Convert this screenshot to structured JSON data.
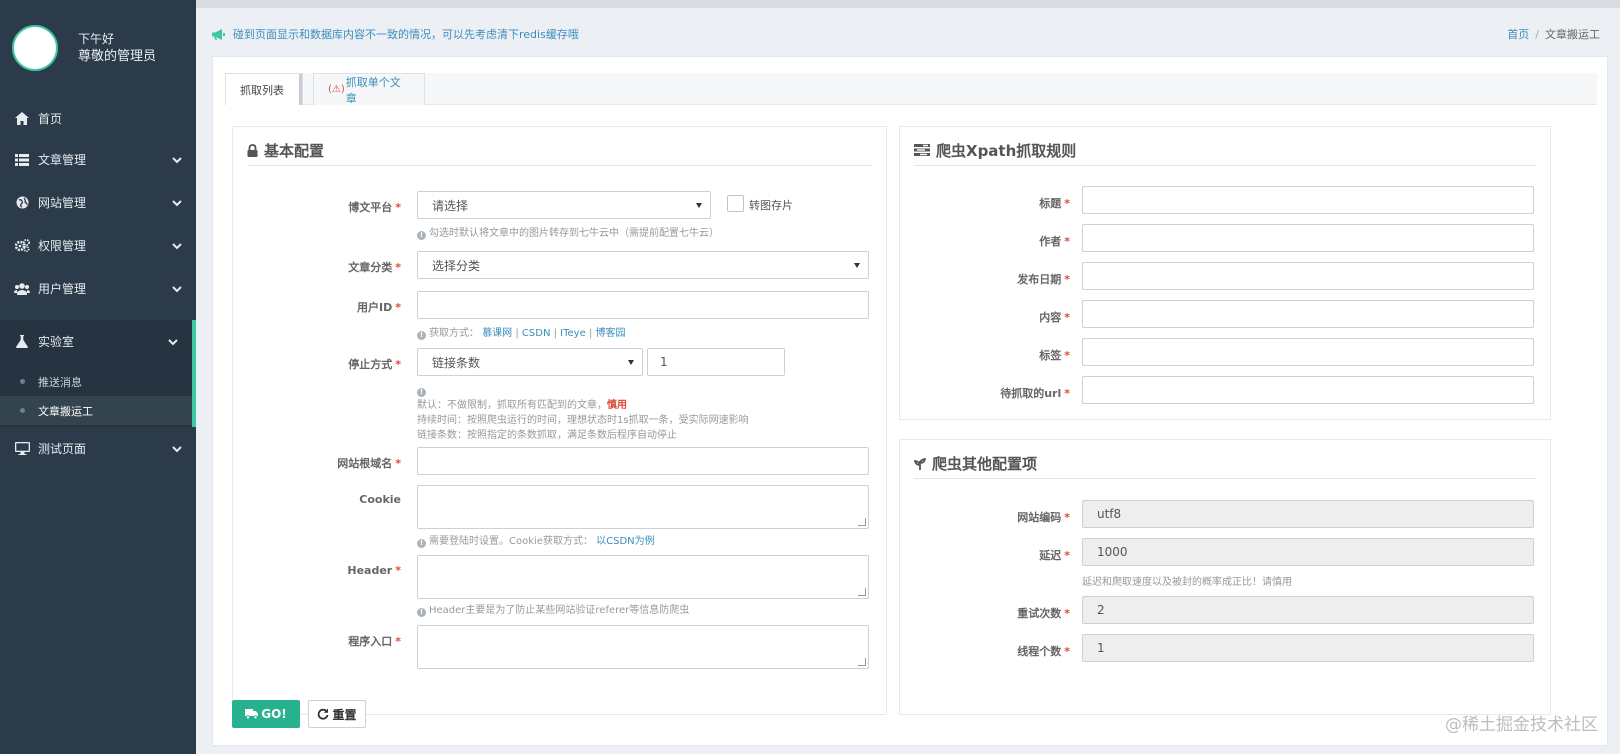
{
  "user": {
    "greeting": "下午好",
    "name": "尊敬的管理员"
  },
  "sidebar": {
    "items": [
      {
        "label": "首页",
        "icon": "home-icon"
      },
      {
        "label": "文章管理",
        "icon": "list-icon"
      },
      {
        "label": "网站管理",
        "icon": "globe-icon"
      },
      {
        "label": "权限管理",
        "icon": "cogs-icon"
      },
      {
        "label": "用户管理",
        "icon": "users-icon"
      },
      {
        "label": "实验室",
        "icon": "flask-icon"
      },
      {
        "label": "测试页面",
        "icon": "desktop-icon"
      }
    ],
    "lab_sub": [
      {
        "label": "推送消息"
      },
      {
        "label": "文章搬运工"
      }
    ]
  },
  "notice": {
    "text": "碰到页面显示和数据库内容不一致的情况，可以先考虑清下redis缓存哦",
    "icon": "bullhorn-icon"
  },
  "breadcrumb": {
    "home": "首页",
    "current": "文章搬运工"
  },
  "tabs": [
    {
      "label": "抓取列表"
    },
    {
      "label": "抓取单个文章",
      "warn": "(⚠)"
    }
  ],
  "basic": {
    "title": "基本配置",
    "platform_label": "博文平台",
    "platform_value": "请选择",
    "convert_label": "转图存片",
    "platform_help": "勾选时默认将文章中的图片转存到七牛云中（需提前配置七牛云）",
    "category_label": "文章分类",
    "category_value": "选择分类",
    "userid_label": "用户ID",
    "userid_help_prefix": "获取方式：",
    "userid_links": [
      "慕课网",
      "CSDN",
      "ITeye",
      "博客园"
    ],
    "stop_label": "停止方式",
    "stop_value": "链接条数",
    "stop_count": "1",
    "stop_help1_a": "默认：不做限制，抓取所有匹配到的文章，",
    "stop_help1_b": "慎用",
    "stop_help2": "持续时间：按照爬虫运行的时间，理想状态时1s抓取一条，受实际网速影响",
    "stop_help3": "链接条数：按照指定的条数抓取，满足条数后程序自动停止",
    "domain_label": "网站根域名",
    "cookie_label": "Cookie",
    "cookie_help_prefix": "需要登陆时设置。Cookie获取方式：",
    "cookie_help_link": "以CSDN为例",
    "header_label": "Header",
    "header_help": "Header主要是为了防止某些网站验证referer等信息防爬虫",
    "entry_label": "程序入口"
  },
  "xpath": {
    "title": "爬虫Xpath抓取规则",
    "fields": [
      "标题",
      "作者",
      "发布日期",
      "内容",
      "标签",
      "待抓取的url"
    ]
  },
  "other": {
    "title": "爬虫其他配置项",
    "encoding_label": "网站编码",
    "encoding_value": "utf8",
    "delay_label": "延迟",
    "delay_value": "1000",
    "delay_help": "延迟和爬取速度以及被封的概率成正比！请慎用",
    "retry_label": "重试次数",
    "retry_value": "2",
    "thread_label": "线程个数",
    "thread_value": "1"
  },
  "buttons": {
    "go": "GO!",
    "reset": "重置"
  },
  "watermark": "@稀土掘金技术社区",
  "colors": {
    "accent": "#27b18f",
    "sidebar": "#2c3b4a",
    "link": "#3c8dbc",
    "required": "#dd4b39"
  }
}
